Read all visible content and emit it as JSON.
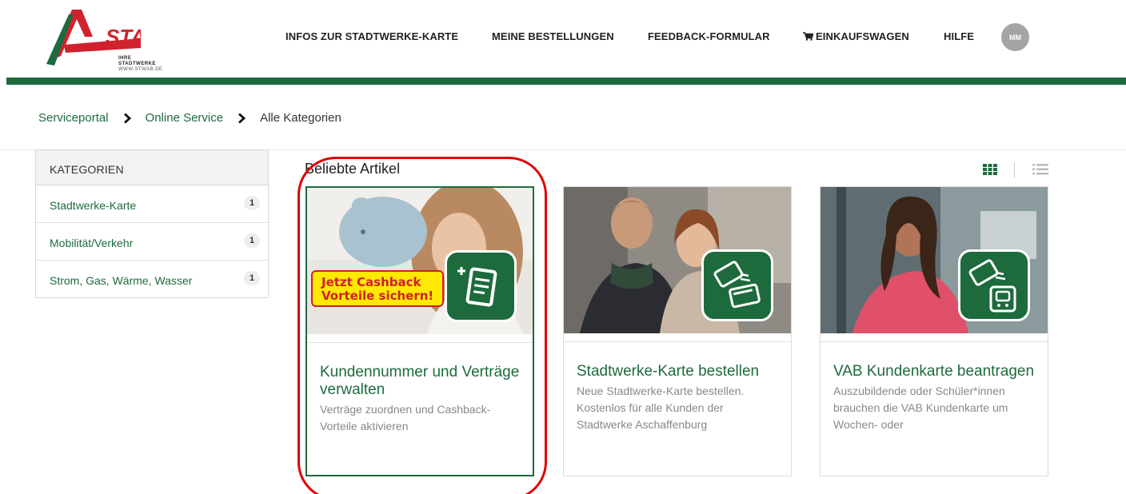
{
  "header": {
    "logo": {
      "brand": "STA",
      "tagline": "IHRE STADTWERKE",
      "url_text": "WWW.STWAB.DE"
    },
    "nav": [
      {
        "label": "INFOS ZUR STADTWERKE-KARTE"
      },
      {
        "label": "MEINE BESTELLUNGEN"
      },
      {
        "label": "FEEDBACK-FORMULAR"
      },
      {
        "label": "EINKAUFSWAGEN",
        "icon": "cart-icon"
      },
      {
        "label": "HILFE"
      }
    ],
    "avatar_initials": "MM"
  },
  "breadcrumb": {
    "items": [
      "Serviceportal",
      "Online Service"
    ],
    "current": "Alle Kategorien"
  },
  "sidebar": {
    "title": "KATEGORIEN",
    "items": [
      {
        "label": "Stadtwerke-Karte",
        "count": "1"
      },
      {
        "label": "Mobilität/Verkehr",
        "count": "1"
      },
      {
        "label": "Strom, Gas, Wärme, Wasser",
        "count": "1"
      }
    ]
  },
  "main": {
    "section_title": "Beliebte Artikel",
    "view_icons": [
      "grid-view-icon",
      "list-view-icon"
    ],
    "cards": [
      {
        "title": "Kundennummer und Verträge verwalten",
        "description": "Verträge zuordnen und Cashback-Vorteile aktivieren",
        "promo": "Jetzt Cashback Vorteile sichern!",
        "icon": "contract-list-icon"
      },
      {
        "title": "Stadtwerke-Karte bestellen",
        "description": "Neue Stadtwerke-Karte bestellen. Kostenlos für alle Kunden der Stadtwerke Aschaffenburg",
        "icon": "card-order-icon"
      },
      {
        "title": "VAB Kundenkarte beantragen",
        "description": "Auszubildende oder Schüler*innen brauchen die VAB Kundenkarte um Wochen- oder",
        "icon": "bus-card-icon"
      }
    ]
  },
  "colors": {
    "brand_green": "#1d6b3d",
    "logo_red": "#d0222e",
    "highlight_red": "#e00000",
    "promo_yellow": "#ffe900"
  }
}
